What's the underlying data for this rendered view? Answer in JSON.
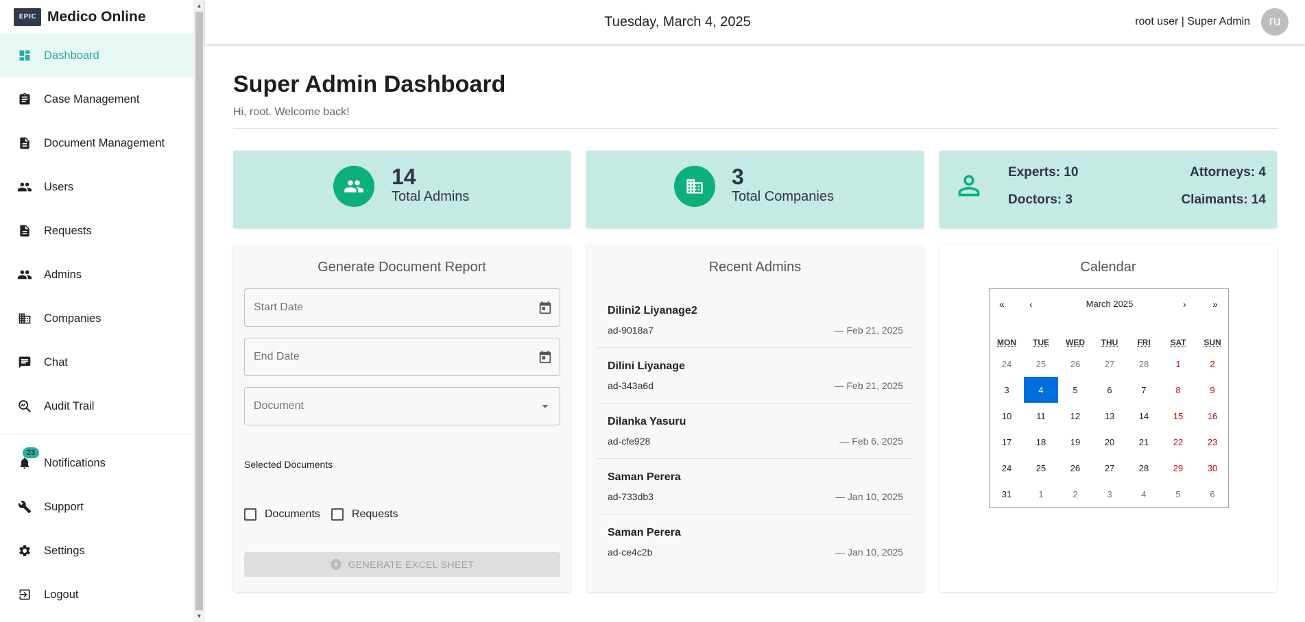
{
  "brand": {
    "logo_text": "EPIC",
    "name": "Medico Online"
  },
  "sidebar": {
    "items": [
      {
        "label": "Dashboard",
        "icon": "dashboard-icon",
        "active": true
      },
      {
        "label": "Case Management",
        "icon": "clipboard-icon"
      },
      {
        "label": "Document Management",
        "icon": "document-icon"
      },
      {
        "label": "Users",
        "icon": "people-icon"
      },
      {
        "label": "Requests",
        "icon": "document-icon"
      },
      {
        "label": "Admins",
        "icon": "people-icon"
      },
      {
        "label": "Companies",
        "icon": "building-icon"
      },
      {
        "label": "Chat",
        "icon": "chat-icon"
      },
      {
        "label": "Audit Trail",
        "icon": "audit-icon"
      }
    ],
    "bottom_items": [
      {
        "label": "Notifications",
        "icon": "bell-icon",
        "badge": "23"
      },
      {
        "label": "Support",
        "icon": "wrench-icon"
      },
      {
        "label": "Settings",
        "icon": "gear-icon"
      },
      {
        "label": "Logout",
        "icon": "logout-icon"
      }
    ]
  },
  "header": {
    "date": "Tuesday, March 4, 2025",
    "user": "root user | Super Admin",
    "avatar_initials": "ru"
  },
  "page": {
    "title": "Super Admin Dashboard",
    "subtitle": "Hi, root. Welcome back!"
  },
  "stats": {
    "admins": {
      "value": "14",
      "label": "Total Admins"
    },
    "companies": {
      "value": "3",
      "label": "Total Companies"
    },
    "breakdown": {
      "experts": "Experts: 10",
      "attorneys": "Attorneys: 4",
      "doctors": "Doctors: 3",
      "claimants": "Claimants: 14"
    }
  },
  "report": {
    "title": "Generate Document Report",
    "start_placeholder": "Start Date",
    "end_placeholder": "End Date",
    "document_placeholder": "Document",
    "selected_label": "Selected Documents",
    "checkbox_documents": "Documents",
    "checkbox_requests": "Requests",
    "button": "GENERATE EXCEL SHEET"
  },
  "recent_admins": {
    "title": "Recent Admins",
    "items": [
      {
        "name": "Dilini2 Liyanage2",
        "id": "ad-9018a7",
        "date": "— Feb 21, 2025"
      },
      {
        "name": "Dilini Liyanage",
        "id": "ad-343a6d",
        "date": "— Feb 21, 2025"
      },
      {
        "name": "Dilanka Yasuru",
        "id": "ad-cfe928",
        "date": "— Feb 6, 2025"
      },
      {
        "name": "Saman Perera",
        "id": "ad-733db3",
        "date": "— Jan 10, 2025"
      },
      {
        "name": "Saman Perera",
        "id": "ad-ce4c2b",
        "date": "— Jan 10, 2025"
      }
    ]
  },
  "calendar": {
    "title": "Calendar",
    "month": "March 2025",
    "nav": {
      "prev2": "«",
      "prev": "‹",
      "next": "›",
      "next2": "»"
    },
    "weekdays": [
      "MON",
      "TUE",
      "WED",
      "THU",
      "FRI",
      "SAT",
      "SUN"
    ],
    "weeks": [
      [
        "24",
        "25",
        "26",
        "27",
        "28",
        "1",
        "2"
      ],
      [
        "3",
        "4",
        "5",
        "6",
        "7",
        "8",
        "9"
      ],
      [
        "10",
        "11",
        "12",
        "13",
        "14",
        "15",
        "16"
      ],
      [
        "17",
        "18",
        "19",
        "20",
        "21",
        "22",
        "23"
      ],
      [
        "24",
        "25",
        "26",
        "27",
        "28",
        "29",
        "30"
      ],
      [
        "31",
        "1",
        "2",
        "3",
        "4",
        "5",
        "6"
      ]
    ],
    "today": "4"
  },
  "colors": {
    "accent": "#26b09a",
    "stat_bg": "#c5e9e3",
    "stat_icon": "#0cb07b",
    "today": "#006edc",
    "weekend": "#d10000"
  }
}
